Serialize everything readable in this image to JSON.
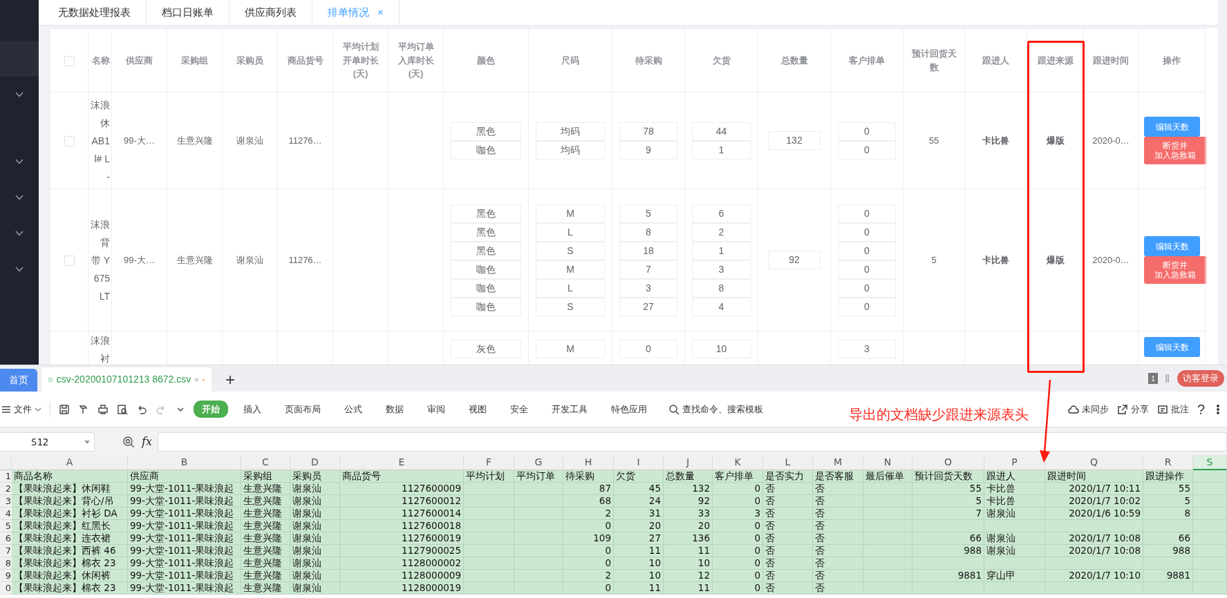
{
  "sidebar": {
    "items": [
      {
        "kind": "plain",
        "selected": true
      },
      {
        "kind": "submenu",
        "selected": false,
        "expanded": false
      },
      {
        "kind": "submenu",
        "selected": false,
        "expanded": false
      },
      {
        "kind": "submenu",
        "selected": false,
        "expanded": false
      },
      {
        "kind": "submenu",
        "selected": false,
        "expanded": false
      },
      {
        "kind": "submenu",
        "selected": false,
        "expanded": false
      }
    ]
  },
  "tabs": [
    {
      "label": "无数据处理报表",
      "selected": false
    },
    {
      "label": "档口日账单",
      "selected": false
    },
    {
      "label": "供应商列表",
      "selected": false
    },
    {
      "label": "排单情况",
      "selected": true,
      "close": "×"
    }
  ],
  "table": {
    "select_all_checked": false,
    "columns": [
      "名称",
      "供应商",
      "采购组",
      "采购员",
      "商品货号",
      "平均计划开单时长(天)",
      "平均订单入库时长(天)",
      "颜色",
      "尺码",
      "待采购",
      "欠货",
      "总数量",
      "客户排单",
      "预计回货天数",
      "跟进人",
      "跟进来源",
      "跟进时间",
      "操作"
    ],
    "rows": [
      {
        "checked": false,
        "name_lines": [
          "沫浪",
          "休",
          "AB1",
          "l# L",
          "-"
        ],
        "supplier": "99-大…",
        "group": "生意兴隆",
        "buyer": "谢泉汕",
        "sku": "11276…",
        "variants": [
          {
            "shade": "黑色",
            "size": "均码",
            "pending": "78",
            "owed": "44",
            "customer": "0"
          },
          {
            "shade": "咖色",
            "size": "均码",
            "pending": "9",
            "owed": "1",
            "customer": "0"
          }
        ],
        "total": "132",
        "days": "55",
        "follower": "卡比兽",
        "source": "爆版",
        "time": "2020-0…",
        "actions": [
          {
            "label": "编辑天数",
            "kind": "primary"
          },
          {
            "label_lines": [
              "断货并",
              "加入急救箱"
            ],
            "kind": "danger"
          }
        ]
      },
      {
        "checked": false,
        "name_lines": [
          "沫浪",
          "背",
          "带 Y",
          "675",
          "LT"
        ],
        "supplier": "99-大…",
        "group": "生意兴隆",
        "buyer": "谢泉汕",
        "sku": "11276…",
        "variants": [
          {
            "shade": "黑色",
            "size": "M",
            "pending": "5",
            "owed": "6",
            "customer": "0"
          },
          {
            "shade": "黑色",
            "size": "L",
            "pending": "8",
            "owed": "2",
            "customer": "0"
          },
          {
            "shade": "黑色",
            "size": "S",
            "pending": "18",
            "owed": "1",
            "customer": "0"
          },
          {
            "shade": "咖色",
            "size": "M",
            "pending": "7",
            "owed": "3",
            "customer": "0"
          },
          {
            "shade": "咖色",
            "size": "L",
            "pending": "3",
            "owed": "8",
            "customer": "0"
          },
          {
            "shade": "咖色",
            "size": "S",
            "pending": "27",
            "owed": "4",
            "customer": "0"
          }
        ],
        "total": "92",
        "days": "5",
        "follower": "卡比兽",
        "source": "爆版",
        "time": "2020-0…",
        "actions": [
          {
            "label": "编辑天数",
            "kind": "primary"
          },
          {
            "label_lines": [
              "断货并",
              "加入急救箱"
            ],
            "kind": "danger"
          }
        ]
      },
      {
        "name_lines": [
          "沫浪",
          "衬"
        ],
        "variants": [
          {
            "shade": "灰色",
            "size": "M",
            "pending": "0",
            "owed": "10",
            "customer": "3"
          }
        ],
        "actions": [
          {
            "label": "编辑天数",
            "kind": "primary"
          }
        ]
      }
    ]
  },
  "spreadsheet": {
    "tabs": [
      {
        "label": "首页",
        "kind": "home",
        "selected": false
      },
      {
        "label": "csv-20200107101213 8672.csv",
        "kind": "file",
        "selected": true,
        "unsaved": true
      }
    ],
    "new_tab": "+",
    "page_count": "1",
    "login": "访客登录",
    "file_menu": "文件",
    "ribbon": [
      {
        "label": "开始",
        "selected": true
      },
      {
        "label": "插入",
        "selected": false
      },
      {
        "label": "页面布局",
        "selected": false
      },
      {
        "label": "公式",
        "selected": false
      },
      {
        "label": "数据",
        "selected": false
      },
      {
        "label": "审阅",
        "selected": false
      },
      {
        "label": "视图",
        "selected": false
      },
      {
        "label": "安全",
        "selected": false
      },
      {
        "label": "开发工具",
        "selected": false
      },
      {
        "label": "特色应用",
        "selected": false
      }
    ],
    "search": "查找命令、搜索模板",
    "right_actions": [
      {
        "label": "未同步",
        "kind": "cloud"
      },
      {
        "label": "分享",
        "kind": "share"
      },
      {
        "label": "批注",
        "kind": "comment"
      }
    ],
    "help": "?",
    "name_box": "S12",
    "fx": "fx",
    "columns": [
      {
        "letter": "A",
        "selected": false
      },
      {
        "letter": "B",
        "selected": false
      },
      {
        "letter": "C",
        "selected": false
      },
      {
        "letter": "D",
        "selected": false
      },
      {
        "letter": "E",
        "selected": false
      },
      {
        "letter": "F",
        "selected": false
      },
      {
        "letter": "G",
        "selected": false
      },
      {
        "letter": "H",
        "selected": false
      },
      {
        "letter": "I",
        "selected": false
      },
      {
        "letter": "J",
        "selected": false
      },
      {
        "letter": "K",
        "selected": false
      },
      {
        "letter": "L",
        "selected": false
      },
      {
        "letter": "M",
        "selected": false
      },
      {
        "letter": "N",
        "selected": false
      },
      {
        "letter": "O",
        "selected": false
      },
      {
        "letter": "P",
        "selected": false
      },
      {
        "letter": "Q",
        "selected": false
      },
      {
        "letter": "R",
        "selected": false
      },
      {
        "letter": "S",
        "selected": true
      }
    ],
    "header_row": {
      "num": "1",
      "cells": [
        "商品名称",
        "供应商",
        "采购组",
        "采购员",
        "商品货号",
        "平均计划",
        "平均订单",
        "待采购",
        "欠货",
        "总数量",
        "客户排单",
        "是否实力",
        "是否客服",
        "最后催单",
        "预计回货天数",
        "跟进人",
        "跟进时间",
        "跟进操作",
        ""
      ]
    },
    "rows": [
      {
        "num": "2",
        "cells": [
          "【果味浪起来】休闲鞋",
          "99-大堂-1011-果味浪起",
          "生意兴隆",
          "谢泉汕",
          "1127600009",
          "",
          "",
          "87",
          "45",
          "132",
          "0",
          "否",
          "否",
          "",
          "55",
          "卡比兽",
          "2020/1/7 10:11",
          "55",
          ""
        ]
      },
      {
        "num": "3",
        "cells": [
          "【果味浪起来】背心/吊",
          "99-大堂-1011-果味浪起",
          "生意兴隆",
          "谢泉汕",
          "1127600012",
          "",
          "",
          "68",
          "24",
          "92",
          "0",
          "否",
          "否",
          "",
          "5",
          "卡比兽",
          "2020/1/7 10:02",
          "5",
          ""
        ]
      },
      {
        "num": "4",
        "cells": [
          "【果味浪起来】衬衫 DA",
          "99-大堂-1011-果味浪起",
          "生意兴隆",
          "谢泉汕",
          "1127600014",
          "",
          "",
          "2",
          "31",
          "33",
          "3",
          "否",
          "否",
          "",
          "7",
          "谢泉汕",
          "2020/1/6 10:59",
          "8",
          ""
        ]
      },
      {
        "num": "5",
        "cells": [
          "【果味浪起来】红黑长",
          "99-大堂-1011-果味浪起",
          "生意兴隆",
          "谢泉汕",
          "1127600018",
          "",
          "",
          "0",
          "20",
          "20",
          "0",
          "否",
          "否",
          "",
          "",
          "",
          "",
          "",
          ""
        ]
      },
      {
        "num": "6",
        "cells": [
          "【果味浪起来】连衣裙",
          "99-大堂-1011-果味浪起",
          "生意兴隆",
          "谢泉汕",
          "1127600019",
          "",
          "",
          "109",
          "27",
          "136",
          "0",
          "否",
          "否",
          "",
          "66",
          "谢泉汕",
          "2020/1/7 10:08",
          "66",
          ""
        ]
      },
      {
        "num": "7",
        "cells": [
          "【果味浪起来】西裤 46",
          "99-大堂-1011-果味浪起",
          "生意兴隆",
          "谢泉汕",
          "1127900025",
          "",
          "",
          "0",
          "11",
          "11",
          "0",
          "否",
          "否",
          "",
          "988",
          "谢泉汕",
          "2020/1/7 10:08",
          "988",
          ""
        ]
      },
      {
        "num": "8",
        "cells": [
          "【果味浪起来】棉衣 23",
          "99-大堂-1011-果味浪起",
          "生意兴隆",
          "谢泉汕",
          "1128000002",
          "",
          "",
          "0",
          "10",
          "10",
          "0",
          "否",
          "否",
          "",
          "",
          "",
          "",
          "",
          ""
        ]
      },
      {
        "num": "9",
        "cells": [
          "【果味浪起来】休闲裤",
          "99-大堂-1011-果味浪起",
          "生意兴隆",
          "谢泉汕",
          "1128000009",
          "",
          "",
          "2",
          "10",
          "12",
          "0",
          "否",
          "否",
          "",
          "9881",
          "穿山甲",
          "2020/1/7 10:10",
          "9881",
          ""
        ]
      },
      {
        "num": "0",
        "cells": [
          "【果味浪起来】棉衣 23",
          "99-大堂-1011-果味浪起",
          "生意兴隆",
          "谢泉汕",
          "1128000019",
          "",
          "",
          "0",
          "11",
          "11",
          "0",
          "否",
          "否",
          "",
          "",
          "",
          "",
          "",
          ""
        ]
      }
    ]
  },
  "annotation": {
    "text": "导出的文档缺少跟进来源表头"
  }
}
